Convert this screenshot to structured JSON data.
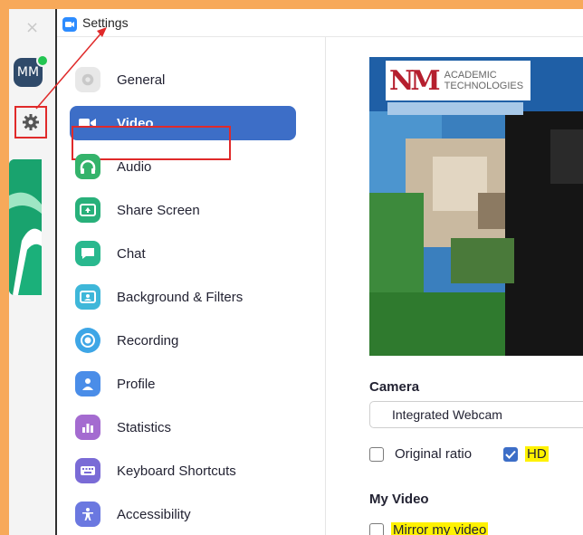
{
  "background_window": {
    "close_glyph": "×",
    "avatar_initials": "MM"
  },
  "window": {
    "title": "Settings"
  },
  "sidebar": {
    "items": [
      {
        "label": "General",
        "icon": "gear-icon",
        "color": "#b8b8b8"
      },
      {
        "label": "Video",
        "icon": "video-camera-icon",
        "color": "#3d6ec7",
        "active": true
      },
      {
        "label": "Audio",
        "icon": "headphones-icon",
        "color": "#34b36b"
      },
      {
        "label": "Share Screen",
        "icon": "share-screen-icon",
        "color": "#28b07a"
      },
      {
        "label": "Chat",
        "icon": "chat-bubble-icon",
        "color": "#29b88e"
      },
      {
        "label": "Background & Filters",
        "icon": "background-icon",
        "color": "#3eb7d9"
      },
      {
        "label": "Recording",
        "icon": "record-icon",
        "color": "#3ea6e6"
      },
      {
        "label": "Profile",
        "icon": "profile-icon",
        "color": "#4a8de8"
      },
      {
        "label": "Statistics",
        "icon": "statistics-icon",
        "color": "#a46bd0"
      },
      {
        "label": "Keyboard Shortcuts",
        "icon": "keyboard-icon",
        "color": "#7a6bd6"
      },
      {
        "label": "Accessibility",
        "icon": "accessibility-icon",
        "color": "#6b78e0"
      }
    ]
  },
  "preview": {
    "logo_mark": "NM",
    "logo_line1": "ACADEMIC",
    "logo_line2": "TECHNOLOGIES"
  },
  "camera": {
    "heading": "Camera",
    "selected": "Integrated Webcam",
    "original_ratio_label": "Original ratio",
    "original_ratio_checked": false,
    "hd_label": "HD",
    "hd_checked": true
  },
  "my_video": {
    "heading": "My Video",
    "mirror_label": "Mirror my video",
    "mirror_checked": false
  },
  "colors": {
    "accent": "#3d6ec7",
    "highlight": "#fff200",
    "annotation": "#e02a2a",
    "frame": "#f7a95a"
  }
}
